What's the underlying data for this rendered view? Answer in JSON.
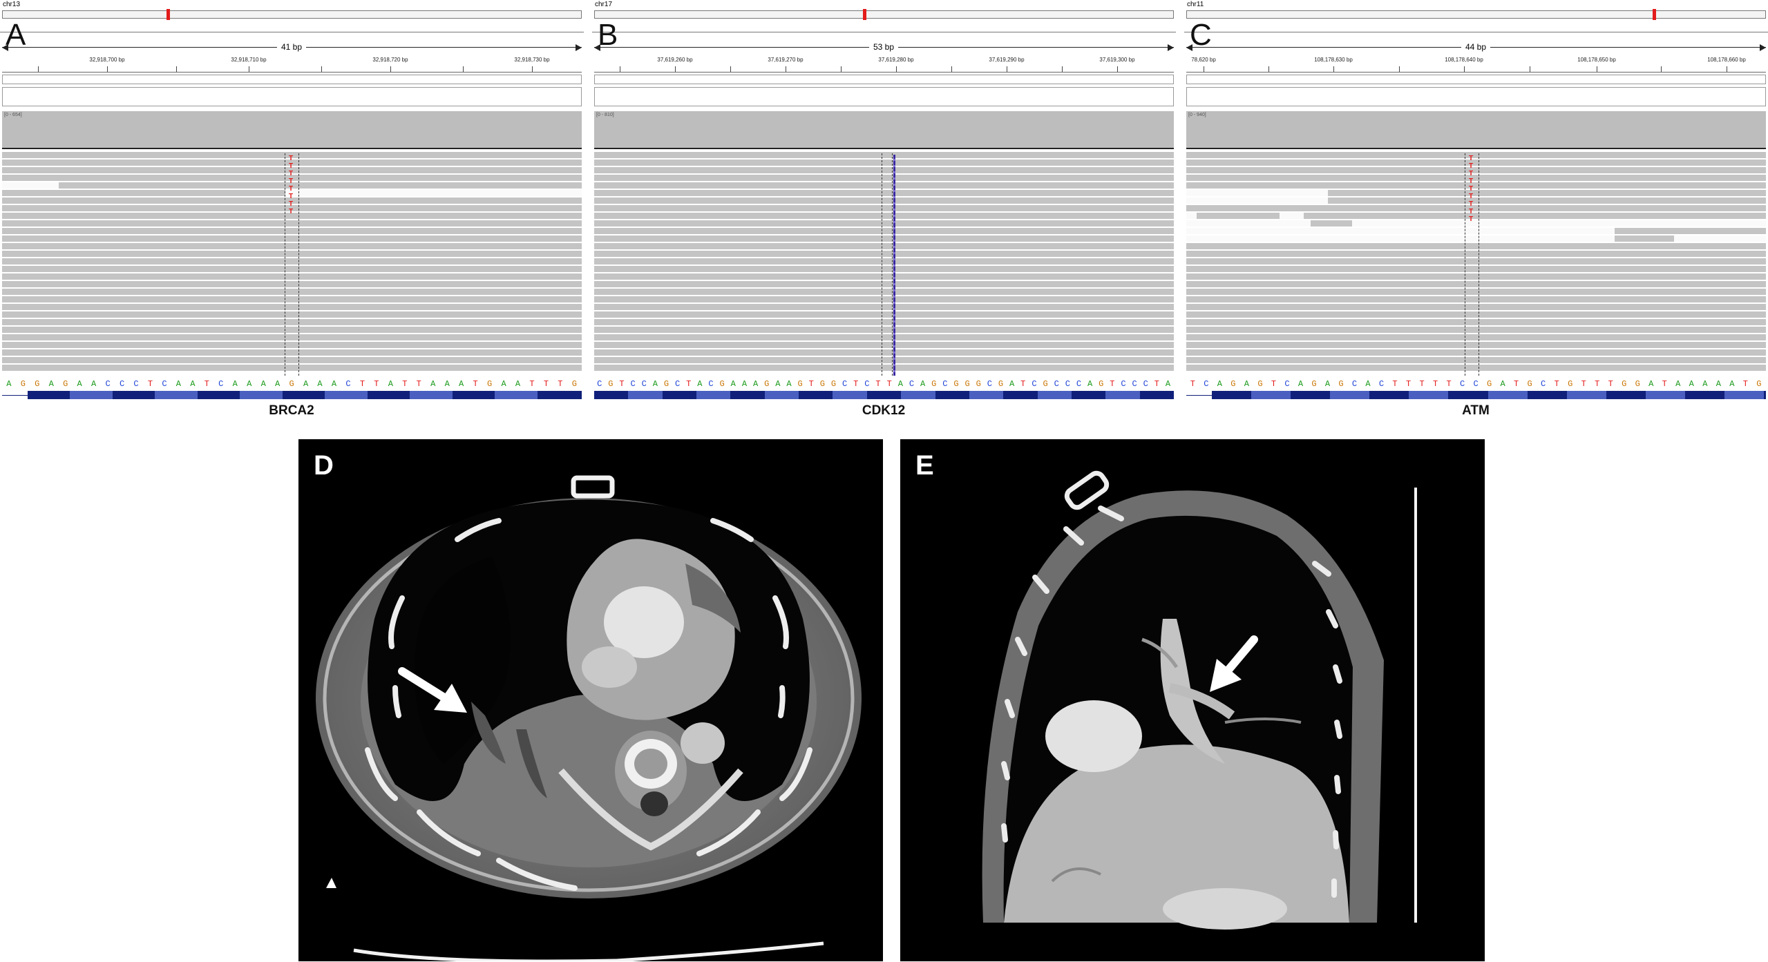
{
  "panels": [
    {
      "letter": "A",
      "chr": "chr13",
      "span": "41 bp",
      "ticks": [
        "32,918,700 bp",
        "32,918,710 bp",
        "32,918,720 bp",
        "32,918,730 bp"
      ],
      "range": "[0 - 654]",
      "sequence": "AGGAGAACCCTCAATCAAAAGAAACTTATTAAATGAATTTG",
      "gene": "BRCA2",
      "mutation": "T"
    },
    {
      "letter": "B",
      "chr": "chr17",
      "span": "53 bp",
      "ticks": [
        "37,619,260 bp",
        "37,619,270 bp",
        "37,619,280 bp",
        "37,619,290 bp",
        "37,619,300 bp"
      ],
      "range": "[0 - 810]",
      "sequence": "CGTCCAGCTACGAAAGAAGTGGCTCTTACAGCGGGCGATCGCCCAGTCCCTA",
      "gene": "CDK12",
      "mutation": ""
    },
    {
      "letter": "C",
      "chr": "chr11",
      "span": "44 bp",
      "ticks": [
        "78,620 bp",
        "108,178,630 bp",
        "108,178,640 bp",
        "108,178,650 bp",
        "108,178,660 bp"
      ],
      "range": "[0 - 940]",
      "sequence": "TCAGAGTCAGAGCACTTTTTCCGATGCTGTTTGGATAAAAATG",
      "gene": "ATM",
      "mutation": "T"
    }
  ],
  "ct": [
    {
      "letter": "D"
    },
    {
      "letter": "E"
    }
  ],
  "colors": {
    "A": "#1a9a1a",
    "C": "#1a3fd6",
    "G": "#c87400",
    "T": "#e31b1b",
    "mutation": "#e31b1b",
    "read": "#c4c4c4",
    "aa_dark": "#10207a",
    "aa_light": "#4a5fc0"
  }
}
